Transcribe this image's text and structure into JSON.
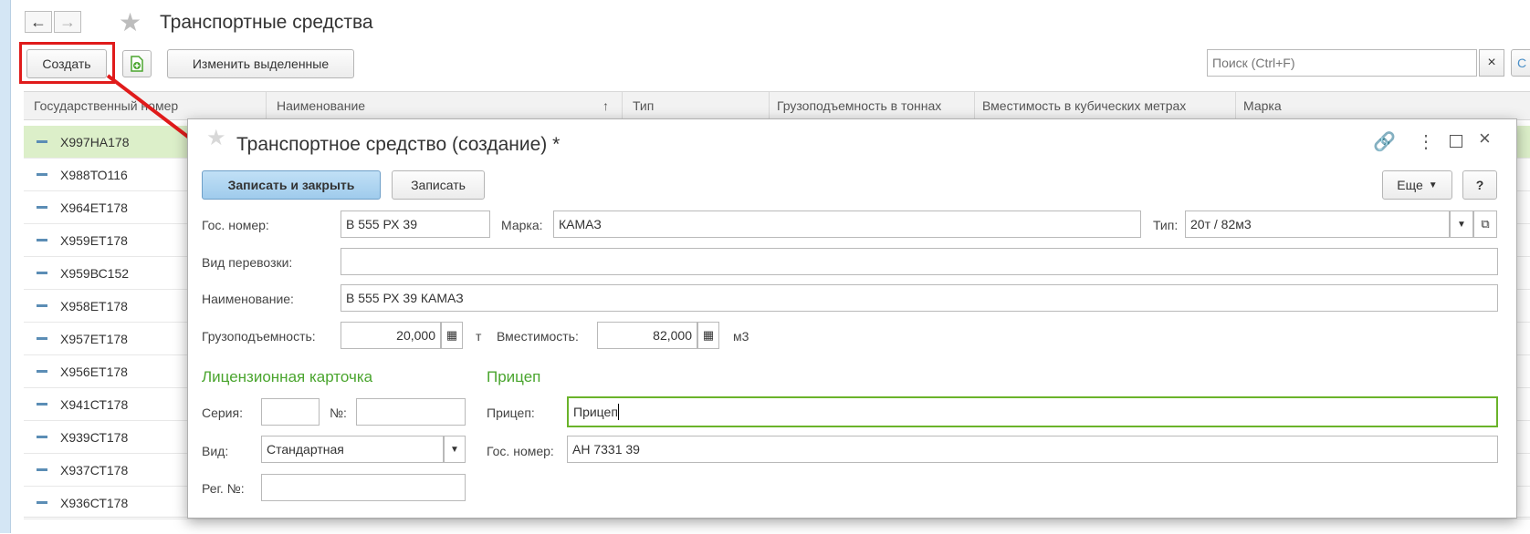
{
  "window": {
    "title": "Транспортные средства"
  },
  "toolbar": {
    "create_label": "Создать",
    "edit_selected_label": "Изменить выделенные"
  },
  "search": {
    "placeholder": "Поиск (Ctrl+F)",
    "clear_label": "×"
  },
  "table": {
    "columns": [
      "Государственный номер",
      "Наименование",
      "↑",
      "Тип",
      "Грузоподъемность в тоннах",
      "Вместимость в кубических метрах",
      "Марка"
    ],
    "rows": [
      {
        "number": "Х997НА178"
      },
      {
        "number": "Х988ТО116"
      },
      {
        "number": "Х964ЕТ178"
      },
      {
        "number": "Х959ЕТ178"
      },
      {
        "number": "Х959ВС152"
      },
      {
        "number": "Х958ЕТ178"
      },
      {
        "number": "Х957ЕТ178"
      },
      {
        "number": "Х956ЕТ178"
      },
      {
        "number": "Х941СТ178"
      },
      {
        "number": "Х939СТ178"
      },
      {
        "number": "Х937СТ178"
      },
      {
        "number": "Х936СТ178"
      }
    ]
  },
  "modal": {
    "title": "Транспортное средство (создание) *",
    "save_close_label": "Записать и закрыть",
    "save_label": "Записать",
    "more_label": "Еще",
    "help_label": "?",
    "fields": {
      "gos_nomer_label": "Гос. номер:",
      "gos_nomer_value": "В 555 РХ 39",
      "marka_label": "Марка:",
      "marka_value": "КАМАЗ",
      "tip_label": "Тип:",
      "tip_value": "20т / 82м3",
      "vid_perevozki_label": "Вид перевозки:",
      "vid_perevozki_value": "",
      "naimenovanie_label": "Наименование:",
      "naimenovanie_value": "В 555 РХ 39 КАМАЗ",
      "gruz_label": "Грузоподъемность:",
      "gruz_value": "20,000",
      "gruz_unit": "т",
      "vmest_label": "Вместимость:",
      "vmest_value": "82,000",
      "vmest_unit": "м3"
    },
    "license": {
      "heading": "Лицензионная карточка",
      "seria_label": "Серия:",
      "seria_value": "",
      "no_label": "№:",
      "no_value": "",
      "vid_label": "Вид:",
      "vid_value": "Стандартная",
      "reg_label": "Рег. №:",
      "reg_value": ""
    },
    "trailer": {
      "heading": "Прицеп",
      "pricep_label": "Прицеп:",
      "pricep_value": "Прицеп",
      "gos_label": "Гос. номер:",
      "gos_value": "АН 7331 39"
    }
  },
  "colors": {
    "accent_green": "#4aa52e",
    "highlight_red": "#e01b1b",
    "selected_row": "#dcefc9",
    "primary_button": "#a9d2ef"
  }
}
